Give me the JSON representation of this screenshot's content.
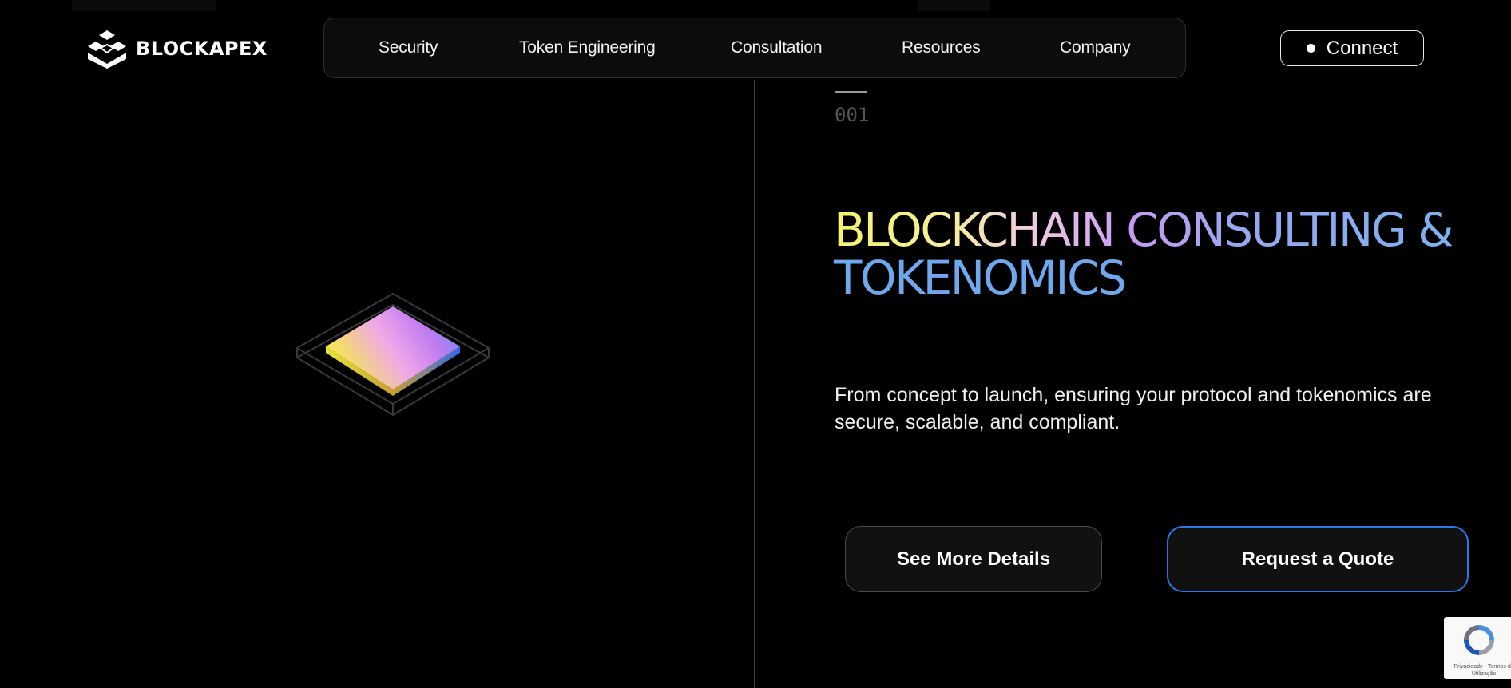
{
  "brand": {
    "name": "BLOCKAPEX",
    "logo_icon": "blockapex-logo-icon"
  },
  "nav": {
    "items": [
      {
        "label": "Security"
      },
      {
        "label": "Token Engineering"
      },
      {
        "label": "Consultation"
      },
      {
        "label": "Resources"
      },
      {
        "label": "Company"
      }
    ]
  },
  "connect": {
    "label": "Connect",
    "icon": "status-dot-icon"
  },
  "hero": {
    "index": "001",
    "headline_line1": "BLOCKCHAIN CONSULTING &",
    "headline_line2": "TOKENOMICS",
    "description": "From concept to launch, ensuring your protocol and tokenomics are secure, scalable, and compliant.",
    "primary_button": "See More Details",
    "secondary_button": "Request a Quote",
    "art_icon": "gradient-layer-stack-icon"
  },
  "recaptcha": {
    "text": "Privacidade - Termos de Utilização",
    "icon": "recaptcha-icon"
  },
  "colors": {
    "background": "#000000",
    "accent_blue": "#2a78e8",
    "gradient_yellow": "#f7f26a",
    "gradient_pink": "#efc9e6",
    "gradient_violet": "#c79af2",
    "gradient_blue": "#7ab2ee"
  }
}
